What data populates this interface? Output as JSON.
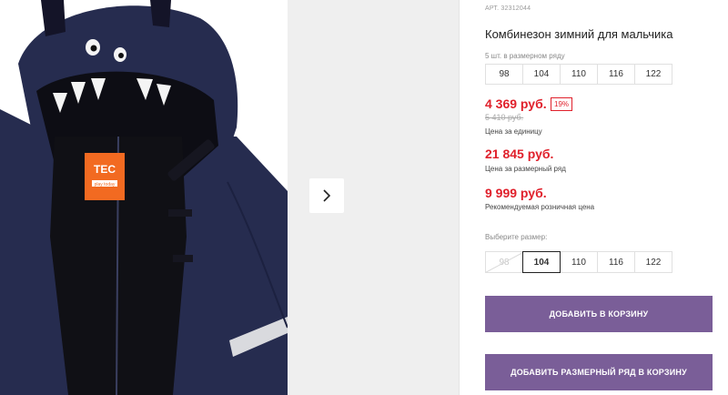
{
  "product": {
    "article": "АРТ. 32312044",
    "title": "Комбинезон зимний для мальчика",
    "pack_label": "5 шт. в размерном ряду",
    "pack_sizes": [
      "98",
      "104",
      "110",
      "116",
      "122"
    ],
    "price_unit": "4 369 руб.",
    "discount": "19%",
    "old_price": "5 410 руб.",
    "price_unit_caption": "Цена за единицу",
    "price_row": "21 845 руб.",
    "price_row_caption": "Цена за размерный ряд",
    "price_rrp": "9 999 руб.",
    "price_rrp_caption": "Рекомендуемая розничная цена",
    "choose_size_label": "Выберите размер:",
    "sizes": [
      "98",
      "104",
      "110",
      "116",
      "122"
    ],
    "selected_size": "104",
    "unavailable_size": "98",
    "add_to_cart": "ДОБАВИТЬ В КОРЗИНУ",
    "add_row_to_cart": "ДОБАВИТЬ РАЗМЕРНЫЙ РЯД В КОРЗИНУ"
  },
  "label_tag": {
    "brand": "TEC",
    "sub": "play today"
  },
  "colors": {
    "accent_purple": "#7a5e98",
    "price_red": "#e0202b",
    "jacket_navy": "#262c4f"
  },
  "icons": {
    "next": "chevron-right-icon"
  }
}
